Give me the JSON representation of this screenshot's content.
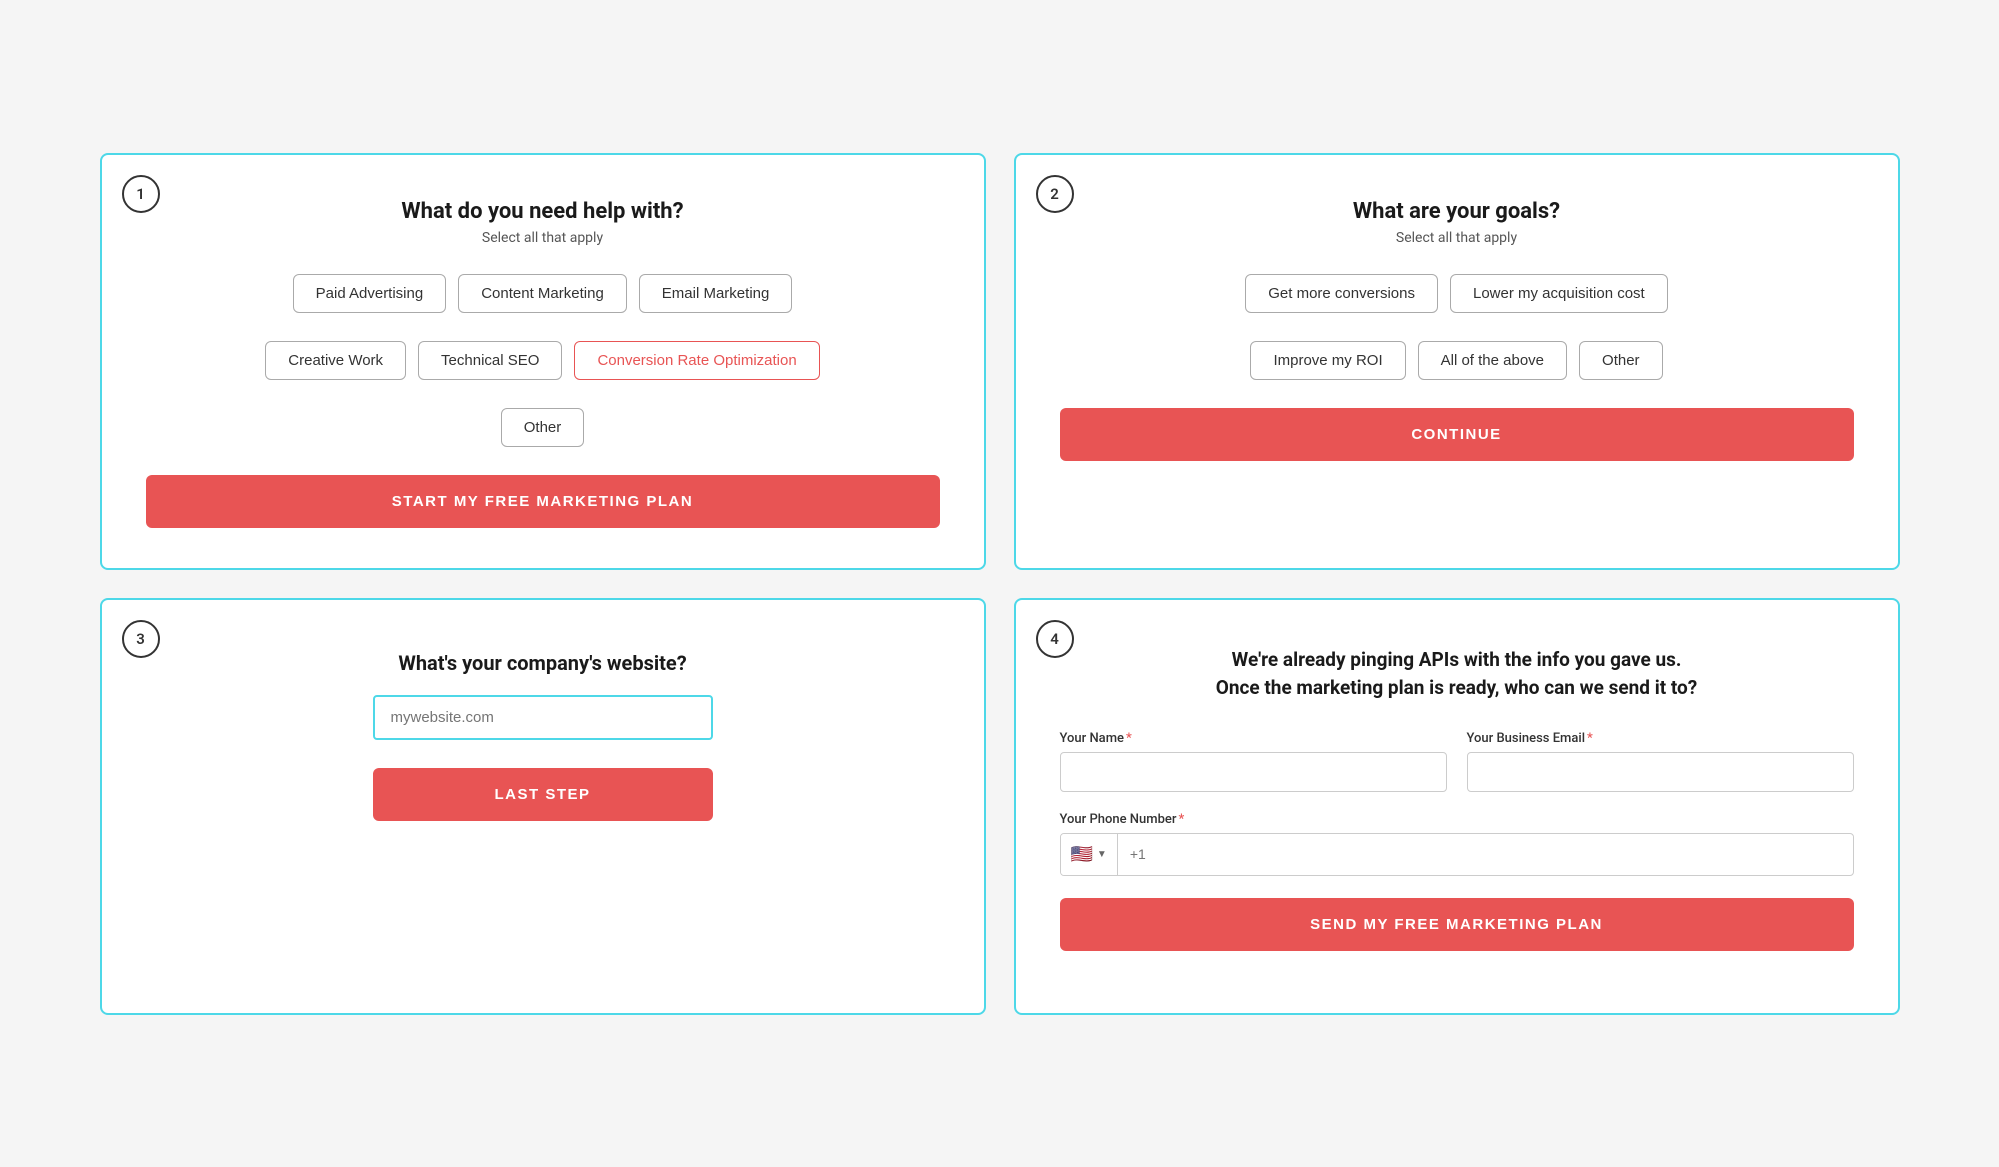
{
  "card1": {
    "step": "1",
    "title": "What do you need help with?",
    "subtitle": "Select all that apply",
    "options": [
      {
        "label": "Paid Advertising",
        "selected": false
      },
      {
        "label": "Content Marketing",
        "selected": false
      },
      {
        "label": "Email Marketing",
        "selected": false
      },
      {
        "label": "Creative Work",
        "selected": false
      },
      {
        "label": "Technical SEO",
        "selected": false
      },
      {
        "label": "Conversion Rate Optimization",
        "selected": true
      },
      {
        "label": "Other",
        "selected": false
      }
    ],
    "cta": "START MY FREE MARKETING PLAN"
  },
  "card2": {
    "step": "2",
    "title": "What are your goals?",
    "subtitle": "Select all that apply",
    "options": [
      {
        "label": "Get more conversions",
        "selected": false
      },
      {
        "label": "Lower my acquisition cost",
        "selected": false
      },
      {
        "label": "Improve my ROI",
        "selected": false
      },
      {
        "label": "All of the above",
        "selected": false
      },
      {
        "label": "Other",
        "selected": false
      }
    ],
    "cta": "CONTINUE"
  },
  "card3": {
    "step": "3",
    "question": "What's your company's website?",
    "input_placeholder": "mywebsite.com",
    "cta": "LAST STEP"
  },
  "card4": {
    "step": "4",
    "header_line1": "We're already pinging APIs with the info you gave us.",
    "header_line2": "Once the marketing plan is ready, who can we send it to?",
    "name_label": "Your Name",
    "email_label": "Your Business Email",
    "phone_label": "Your Phone Number",
    "phone_flag": "🇺🇸",
    "phone_code": "+1",
    "cta": "SEND MY FREE MARKETING PLAN"
  }
}
